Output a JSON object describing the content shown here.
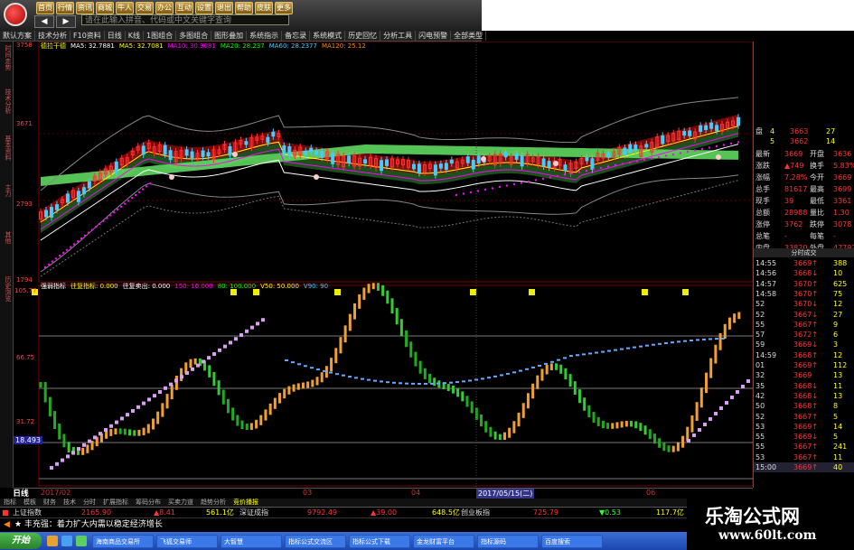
{
  "toolbar": {
    "buttons": [
      "首页",
      "行情",
      "资讯",
      "商城",
      "牛人",
      "交易",
      "办公",
      "互动",
      "设置",
      "退出",
      "帮助",
      "皮肤",
      "更多"
    ],
    "nav_back": "◀",
    "nav_forward": "▶",
    "search_placeholder": "请在此输入拼音、代码或中文关键字查询"
  },
  "menubar": {
    "items": [
      "默认方案",
      "技术分析",
      "F10资料",
      "日线",
      "K线",
      "1图组合",
      "多图组合",
      "图形叠加",
      "系统指示",
      "备忘录",
      "系统模式",
      "历史回忆",
      "分析工具",
      "闪电预警",
      "全部类型"
    ]
  },
  "side_tabs": [
    "时间走势",
    "技术分析",
    "基本资料",
    "主力",
    "其他",
    "历史浏览"
  ],
  "price_info": {
    "label": "德拉干德",
    "ma_items": [
      "MA5: 32.7881",
      "MA5: 32.7081",
      "MA10: 30.9081",
      "MA20: 28.237",
      "MA60: 28.2377",
      "MA120: 25.12"
    ]
  },
  "price_axis": {
    "top": "3758",
    "mid": "3671",
    "lower": "2793",
    "bottom": "1794"
  },
  "indicator_info": {
    "name": "强弱指标",
    "items": [
      "往复指标: 0.000",
      "往复卖出: 0.000",
      "150: 10.000",
      "80: 100.000",
      "V50: 50.000",
      "V90: 90"
    ]
  },
  "indicator_axis": {
    "top": "105.77",
    "mid": "66.75",
    "lower": "31.72",
    "current": "18.493"
  },
  "time_axis": {
    "labels": [
      "日线",
      "2017/02",
      "03",
      "04",
      "05",
      "06"
    ],
    "date_box": "2017/05/15(二)"
  },
  "sub_tabs": [
    "指标",
    "模板",
    "财务",
    "技术",
    "分时",
    "扩展指标",
    "筹码分布",
    "买卖力道",
    "趋势分析",
    "竞价播报"
  ],
  "status_bar": {
    "index1_name": "上证指数",
    "index1_value": "2165.90",
    "index1_change": "▲8.41",
    "amount1": "561.1亿",
    "index2_name": "深证成指",
    "index2_value": "9792.49",
    "index2_change": "▲39.00",
    "amount2": "648.5亿",
    "index3_name": "创业板指",
    "index3_value": "725.79",
    "index3_change": "▼0.53",
    "amount3": "117.7亿"
  },
  "message": "★ 丰充强：着力扩大内需以稳定经济增长",
  "taskbar": {
    "start": "开始",
    "tasks": [
      "海南商品交易所",
      "飞狐交易师",
      "大智慧",
      "指标公式交流区",
      "指标公式下载",
      "金龙财富平台",
      "指标源码",
      "百度搜索"
    ]
  },
  "quote_panel": {
    "bid_ask": [
      {
        "label": "盘",
        "num": "4",
        "price": "3663",
        "vol": "27"
      },
      {
        "label": "",
        "num": "5",
        "price": "3662",
        "vol": "14"
      }
    ],
    "stats": [
      {
        "l": "最新",
        "v": "3669",
        "l2": "开盘",
        "v2": "3636"
      },
      {
        "l": "涨跌",
        "v": "▲749",
        "l2": "换手",
        "v2": "5.83%"
      },
      {
        "l": "涨幅",
        "v": "7.28%",
        "l2": "今开",
        "v2": "3669"
      },
      {
        "l": "总手",
        "v": "81617",
        "l2": "最高",
        "v2": "3699"
      },
      {
        "l": "现手",
        "v": "39",
        "l2": "最低",
        "v2": "3361"
      },
      {
        "l": "总额",
        "v": "28988",
        "l2": "量比",
        "v2": "1.30"
      },
      {
        "l": "涨停",
        "v": "3762",
        "l2": "跌停",
        "v2": "3078"
      },
      {
        "l": "总笔",
        "v": "-",
        "l2": "每笔",
        "v2": "-"
      },
      {
        "l": "内盘",
        "v": "33820",
        "l2": "外盘",
        "v2": "47797"
      }
    ],
    "ticks_header": "分时成交",
    "ticks": [
      {
        "t": "14:55",
        "p": "3669↑",
        "v": "388"
      },
      {
        "t": "14:56",
        "p": "3668↓",
        "v": "10"
      },
      {
        "t": "14:57",
        "p": "3670↑",
        "v": "625"
      },
      {
        "t": "14:58",
        "p": "3670↑",
        "v": "75"
      },
      {
        "t": "52",
        "p": "3670↓",
        "v": "12"
      },
      {
        "t": "52",
        "p": "3667↓",
        "v": "27"
      },
      {
        "t": "55",
        "p": "3667↑",
        "v": "9"
      },
      {
        "t": "57",
        "p": "3672↑",
        "v": "6"
      },
      {
        "t": "59",
        "p": "3669↓",
        "v": "3"
      },
      {
        "t": "14:59",
        "p": "3668↑",
        "v": "12"
      },
      {
        "t": "01",
        "p": "3669↑",
        "v": "112"
      },
      {
        "t": "32",
        "p": "3669",
        "v": "13"
      },
      {
        "t": "35",
        "p": "3668↓",
        "v": "11"
      },
      {
        "t": "42",
        "p": "3668↓",
        "v": "13"
      },
      {
        "t": "50",
        "p": "3668↑",
        "v": "8"
      },
      {
        "t": "52",
        "p": "3667↑",
        "v": "5"
      },
      {
        "t": "53",
        "p": "3669↑",
        "v": "14"
      },
      {
        "t": "55",
        "p": "3669↓",
        "v": "5"
      },
      {
        "t": "55",
        "p": "3667↑",
        "v": "241"
      },
      {
        "t": "53",
        "p": "3667↑",
        "v": "11"
      },
      {
        "t": "15:00",
        "p": "3669↑",
        "v": "40"
      }
    ]
  },
  "watermark": {
    "line1": "乐淘公式网",
    "line2": "www.60lt.com"
  },
  "colors": {
    "up": "#ff3333",
    "down": "#33ff33",
    "accent": "#ffff00"
  }
}
